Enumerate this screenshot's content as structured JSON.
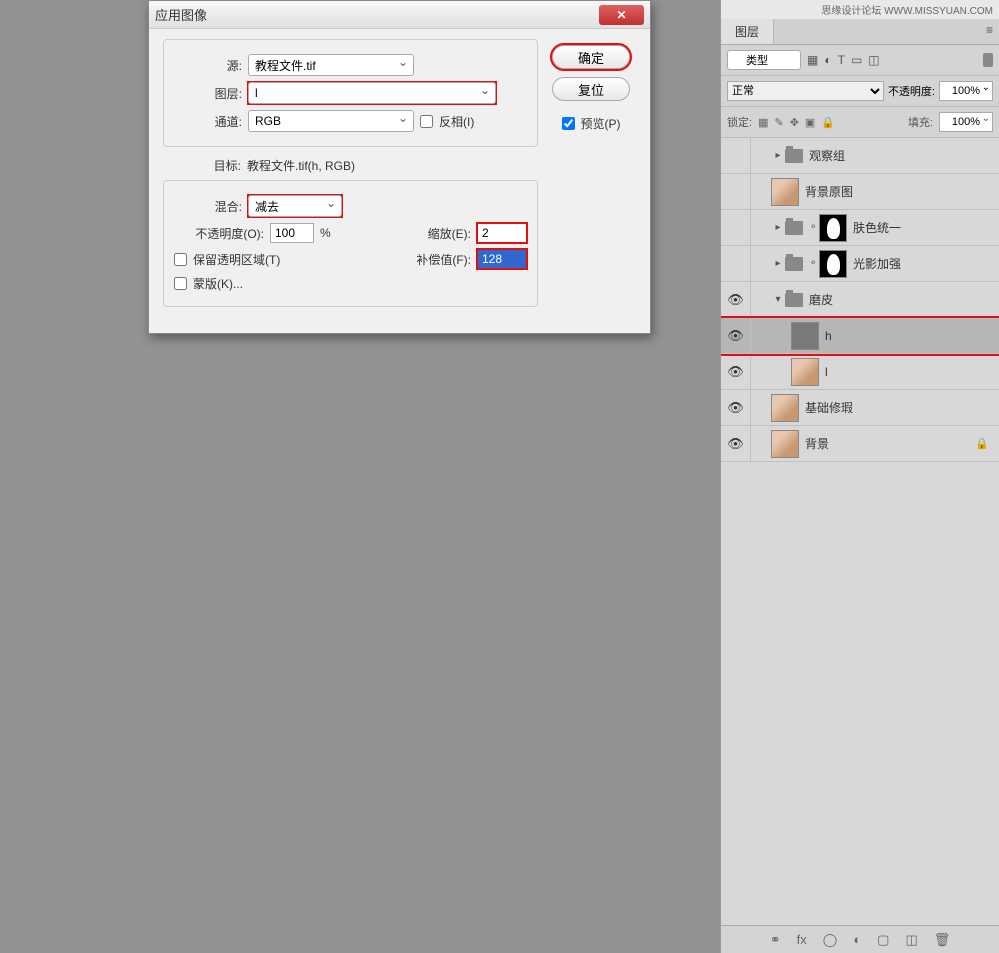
{
  "watermark": "思缘设计论坛 WWW.MISSYUAN.COM",
  "dialog": {
    "title": "应用图像",
    "close": "✕",
    "source_label": "源:",
    "source_value": "教程文件.tif",
    "layer_label": "图层:",
    "layer_value": "l",
    "channel_label": "通道:",
    "channel_value": "RGB",
    "invert_label": "反相(I)",
    "target_label": "目标:",
    "target_value": "教程文件.tif(h, RGB)",
    "blending_label": "混合:",
    "blending_value": "减去",
    "opacity_label": "不透明度(O):",
    "opacity_value": "100",
    "opacity_suffix": "%",
    "scale_label": "缩放(E):",
    "scale_value": "2",
    "offset_label": "补偿值(F):",
    "offset_value": "128",
    "preserve_label": "保留透明区域(T)",
    "mask_label": "蒙版(K)...",
    "ok": "确定",
    "reset": "复位",
    "preview_label": "预览(P)"
  },
  "layers": {
    "tab": "图层",
    "filter_type": "类型",
    "blend_mode": "正常",
    "opacity_label": "不透明度:",
    "opacity_value": "100%",
    "lock_label": "锁定:",
    "fill_label": "填充:",
    "fill_value": "100%",
    "items": [
      {
        "name": "观察组",
        "type": "folder",
        "eye": false,
        "indent": 1,
        "twisty": ">"
      },
      {
        "name": "背景原图",
        "type": "face",
        "eye": false,
        "indent": 1
      },
      {
        "name": "肤色统一",
        "type": "folder-mask",
        "eye": false,
        "indent": 1,
        "twisty": ">"
      },
      {
        "name": "光影加强",
        "type": "folder-mask",
        "eye": false,
        "indent": 1,
        "twisty": ">"
      },
      {
        "name": "磨皮",
        "type": "folder",
        "eye": true,
        "indent": 1,
        "twisty": "v",
        "open": true
      },
      {
        "name": "h",
        "type": "gray",
        "eye": true,
        "indent": 2,
        "selected": true,
        "redbox": true
      },
      {
        "name": "l",
        "type": "face",
        "eye": true,
        "indent": 2
      },
      {
        "name": "基础修瑕",
        "type": "face",
        "eye": true,
        "indent": 1
      },
      {
        "name": "背景",
        "type": "face",
        "eye": true,
        "indent": 1,
        "locked": true
      }
    ]
  }
}
